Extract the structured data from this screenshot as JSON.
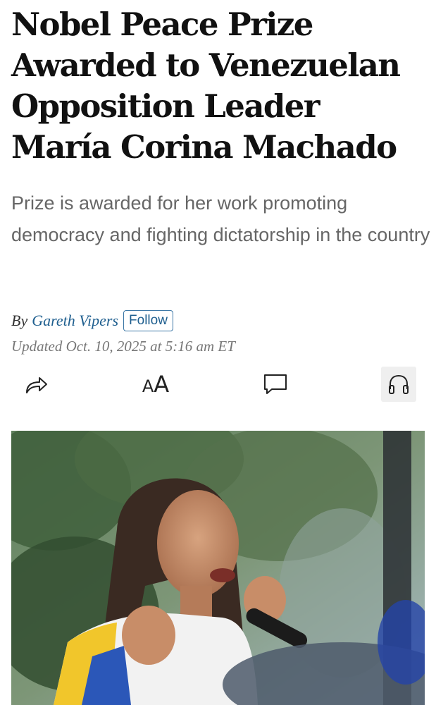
{
  "article": {
    "headline_lines": [
      "Nobel Peace Prize",
      "Awarded to Venezuelan",
      "Opposition Leader",
      "María Corina Machado"
    ],
    "dek": "Prize is awarded for her work promoting democracy and fighting dictatorship in the country",
    "byline": {
      "prefix": "By",
      "author": "Gareth Vipers",
      "follow_label": "Follow"
    },
    "timestamp": "Updated Oct. 10, 2025 at 5:16 am ET"
  },
  "toolbar": {
    "icons": [
      "share-icon",
      "text-size-icon",
      "comment-icon",
      "headphones-icon"
    ],
    "text_size_glyph_small": "A",
    "text_size_glyph_large": "A"
  },
  "colors": {
    "author_link": "#1f5f8f",
    "dek_text": "#666666",
    "timestamp_text": "#777777",
    "listen_button_bg": "#efefef"
  }
}
